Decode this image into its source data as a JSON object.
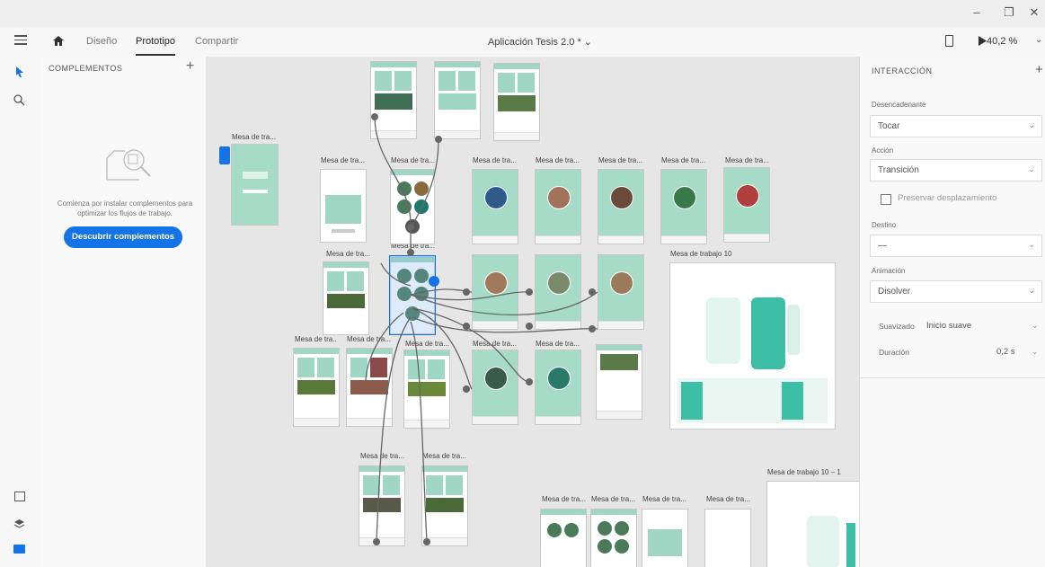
{
  "window": {
    "controls": {
      "minimize": "–",
      "restore": "❐",
      "close": "✕"
    }
  },
  "topbar": {
    "tabs": [
      "Diseño",
      "Prototipo",
      "Compartir"
    ],
    "active_tab": "Prototipo",
    "doc_title": "Aplicación Tesis 2.0 * ⌄",
    "zoom": "40,2 %"
  },
  "leftpanel": {
    "title": "COMPLEMENTOS",
    "empty_text": "Comienza por instalar complementos para optimizar los flujos de trabajo.",
    "discover_button": "Descubrir complementos"
  },
  "canvas": {
    "artboard_label": "Mesa de tra...",
    "artboard_label_short": "Mesa de tra..",
    "artboard_10": "Mesa de trabajo 10",
    "artboard_10_1": "Mesa de trabajo 10 – 1"
  },
  "interaction": {
    "header": "INTERACCIÓN",
    "trigger_label": "Desencadenante",
    "trigger_value": "Tocar",
    "action_label": "Acción",
    "action_value": "Transición",
    "preserve_label": "Preservar desplazamiento",
    "destination_label": "Destino",
    "destination_value": "—",
    "animation_label": "Animación",
    "animation_value": "Disolver",
    "easing_label": "Suavizado",
    "easing_value": "Inicio suave",
    "duration_label": "Duración",
    "duration_value": "0,2 s"
  },
  "colors": {
    "accent": "#1473e6",
    "mint": "#9fd6c4"
  }
}
